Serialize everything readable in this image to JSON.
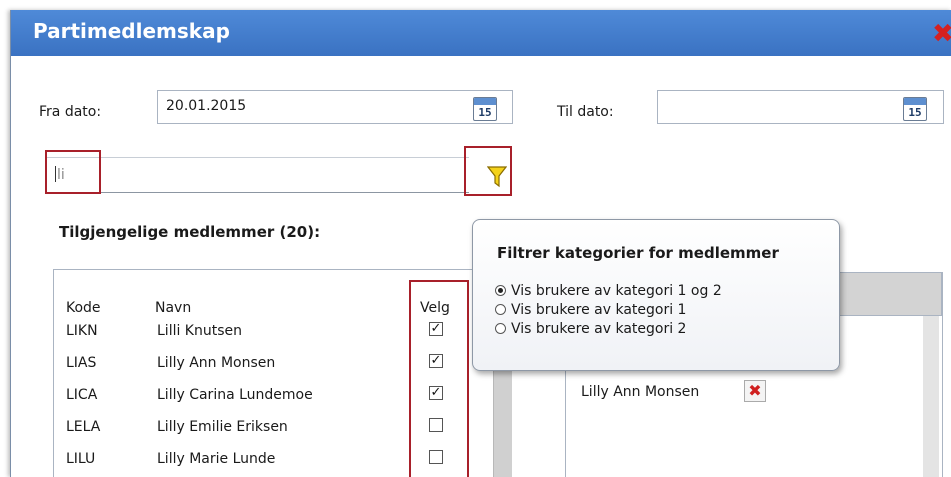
{
  "dialog": {
    "title": "Partimedlemskap",
    "close_icon": "close-icon"
  },
  "dates": {
    "from_label": "Fra dato:",
    "from_value": "20.01.2015",
    "to_label": "Til dato:",
    "to_value": "",
    "calendar_day": "15",
    "calendar_icon": "calendar-icon"
  },
  "search": {
    "value": "li",
    "filter_icon": "funnel-icon"
  },
  "members": {
    "heading": "Tilgjengelige medlemmer (20):",
    "columns": {
      "code": "Kode",
      "name": "Navn",
      "select": "Velg"
    },
    "rows": [
      {
        "code": "LIKN",
        "name": "Lilli Knutsen",
        "checked": true
      },
      {
        "code": "LIAS",
        "name": "Lilly Ann Monsen",
        "checked": true
      },
      {
        "code": "LICA",
        "name": "Lilly Carina Lundemoe",
        "checked": true
      },
      {
        "code": "LELA",
        "name": "Lilly Emilie Eriksen",
        "checked": false
      },
      {
        "code": "LILU",
        "name": "Lilly Marie Lunde",
        "checked": false
      }
    ]
  },
  "filter_popup": {
    "title": "Filtrer kategorier for medlemmer",
    "options": [
      {
        "label": "Vis brukere av kategori 1 og 2",
        "selected": true
      },
      {
        "label": "Vis brukere av kategori 1",
        "selected": false
      },
      {
        "label": "Vis brukere av kategori 2",
        "selected": false
      }
    ]
  },
  "selected": {
    "items": [
      {
        "name": "Lilly Ann Monsen",
        "remove_icon": "close-icon"
      }
    ]
  },
  "colors": {
    "titlebar": "#3a72c2",
    "highlight": "#a8202a",
    "close": "#d42020"
  }
}
